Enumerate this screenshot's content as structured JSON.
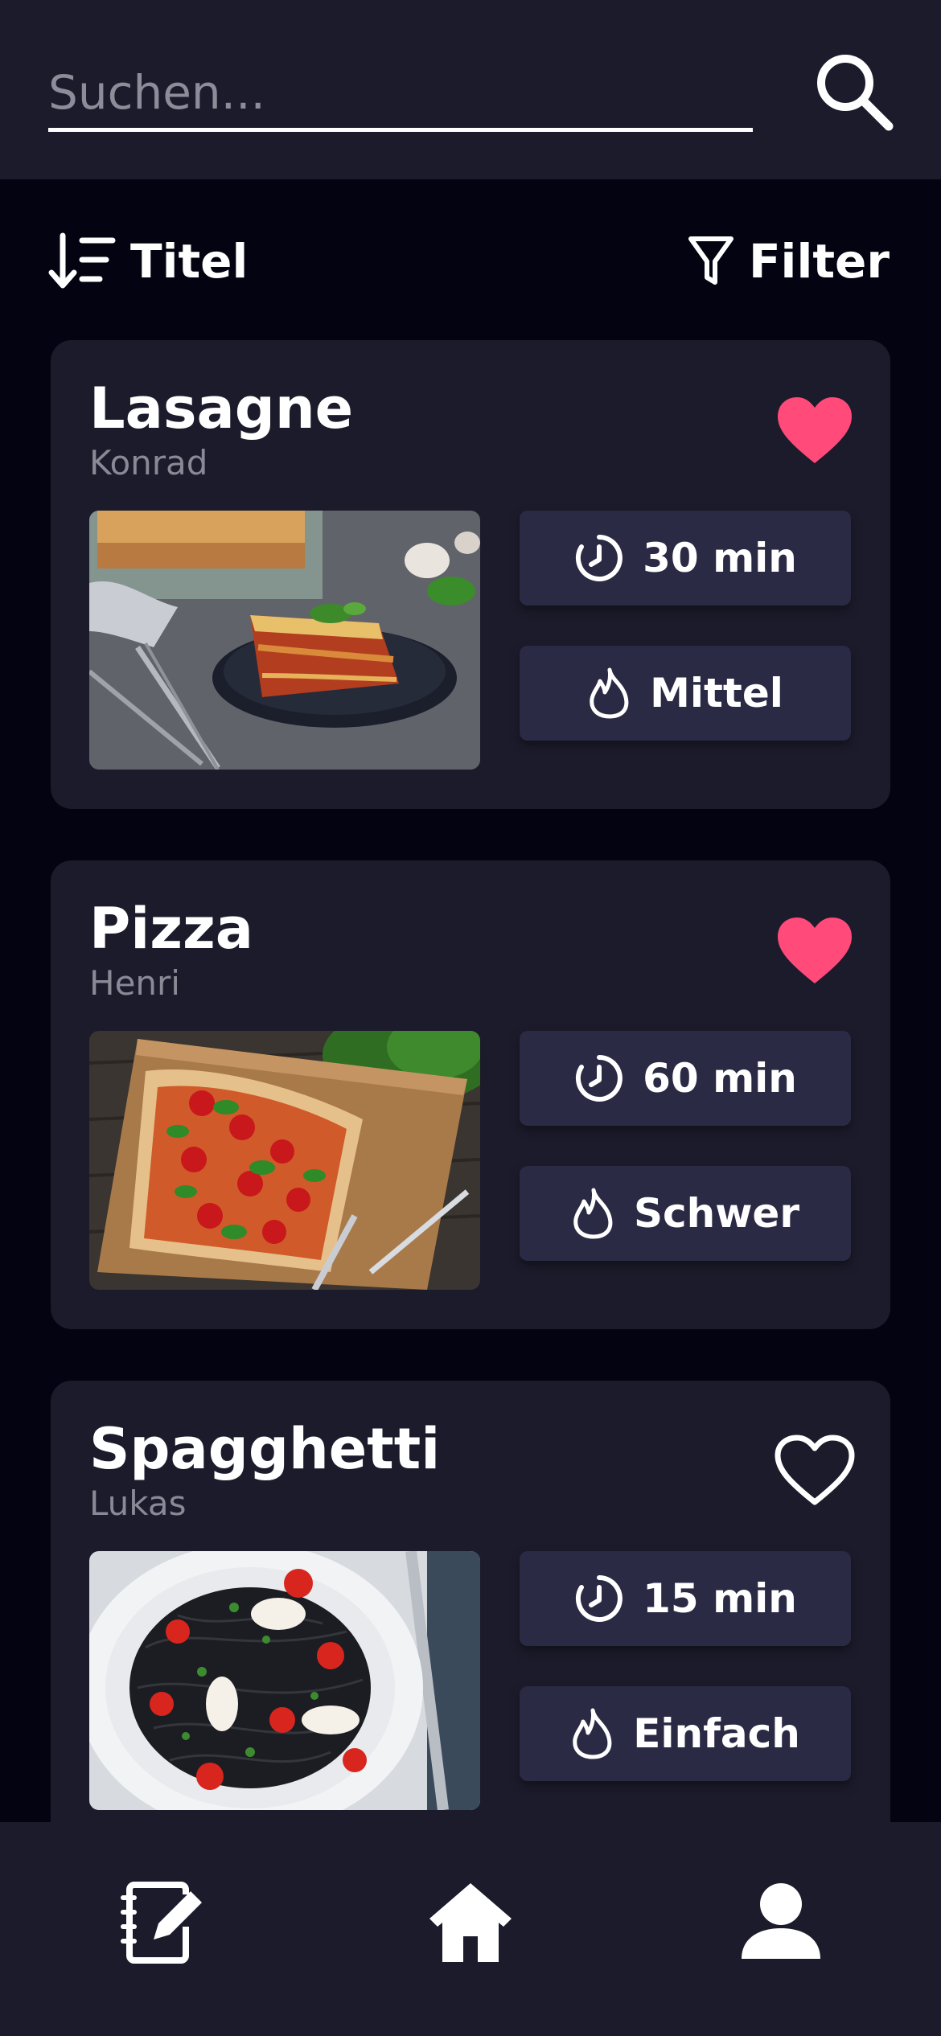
{
  "search": {
    "placeholder": "Suchen..."
  },
  "toolbar": {
    "sort_label": "Titel",
    "filter_label": "Filter"
  },
  "recipes": [
    {
      "title": "Lasagne",
      "author": "Konrad",
      "time": "30 min",
      "difficulty": "Mittel",
      "favorite": true
    },
    {
      "title": "Pizza",
      "author": "Henri",
      "time": "60 min",
      "difficulty": "Schwer",
      "favorite": true
    },
    {
      "title": "Spagghetti",
      "author": "Lukas",
      "time": "15 min",
      "difficulty": "Einfach",
      "favorite": false
    }
  ],
  "colors": {
    "background": "#030311",
    "surface": "#1b1b2b",
    "chip": "#2a2a44",
    "favorite": "#ff4a7a",
    "text_secondary": "#8a8a96"
  },
  "icons": {
    "search": "search-icon",
    "sort": "sort-descending-icon",
    "filter": "filter-funnel-icon",
    "heart_filled": "heart-filled-icon",
    "heart_outline": "heart-outline-icon",
    "clock": "clock-icon",
    "flame": "flame-icon",
    "nav_recipes": "recipe-notebook-edit-icon",
    "nav_home": "home-icon",
    "nav_profile": "profile-icon"
  }
}
